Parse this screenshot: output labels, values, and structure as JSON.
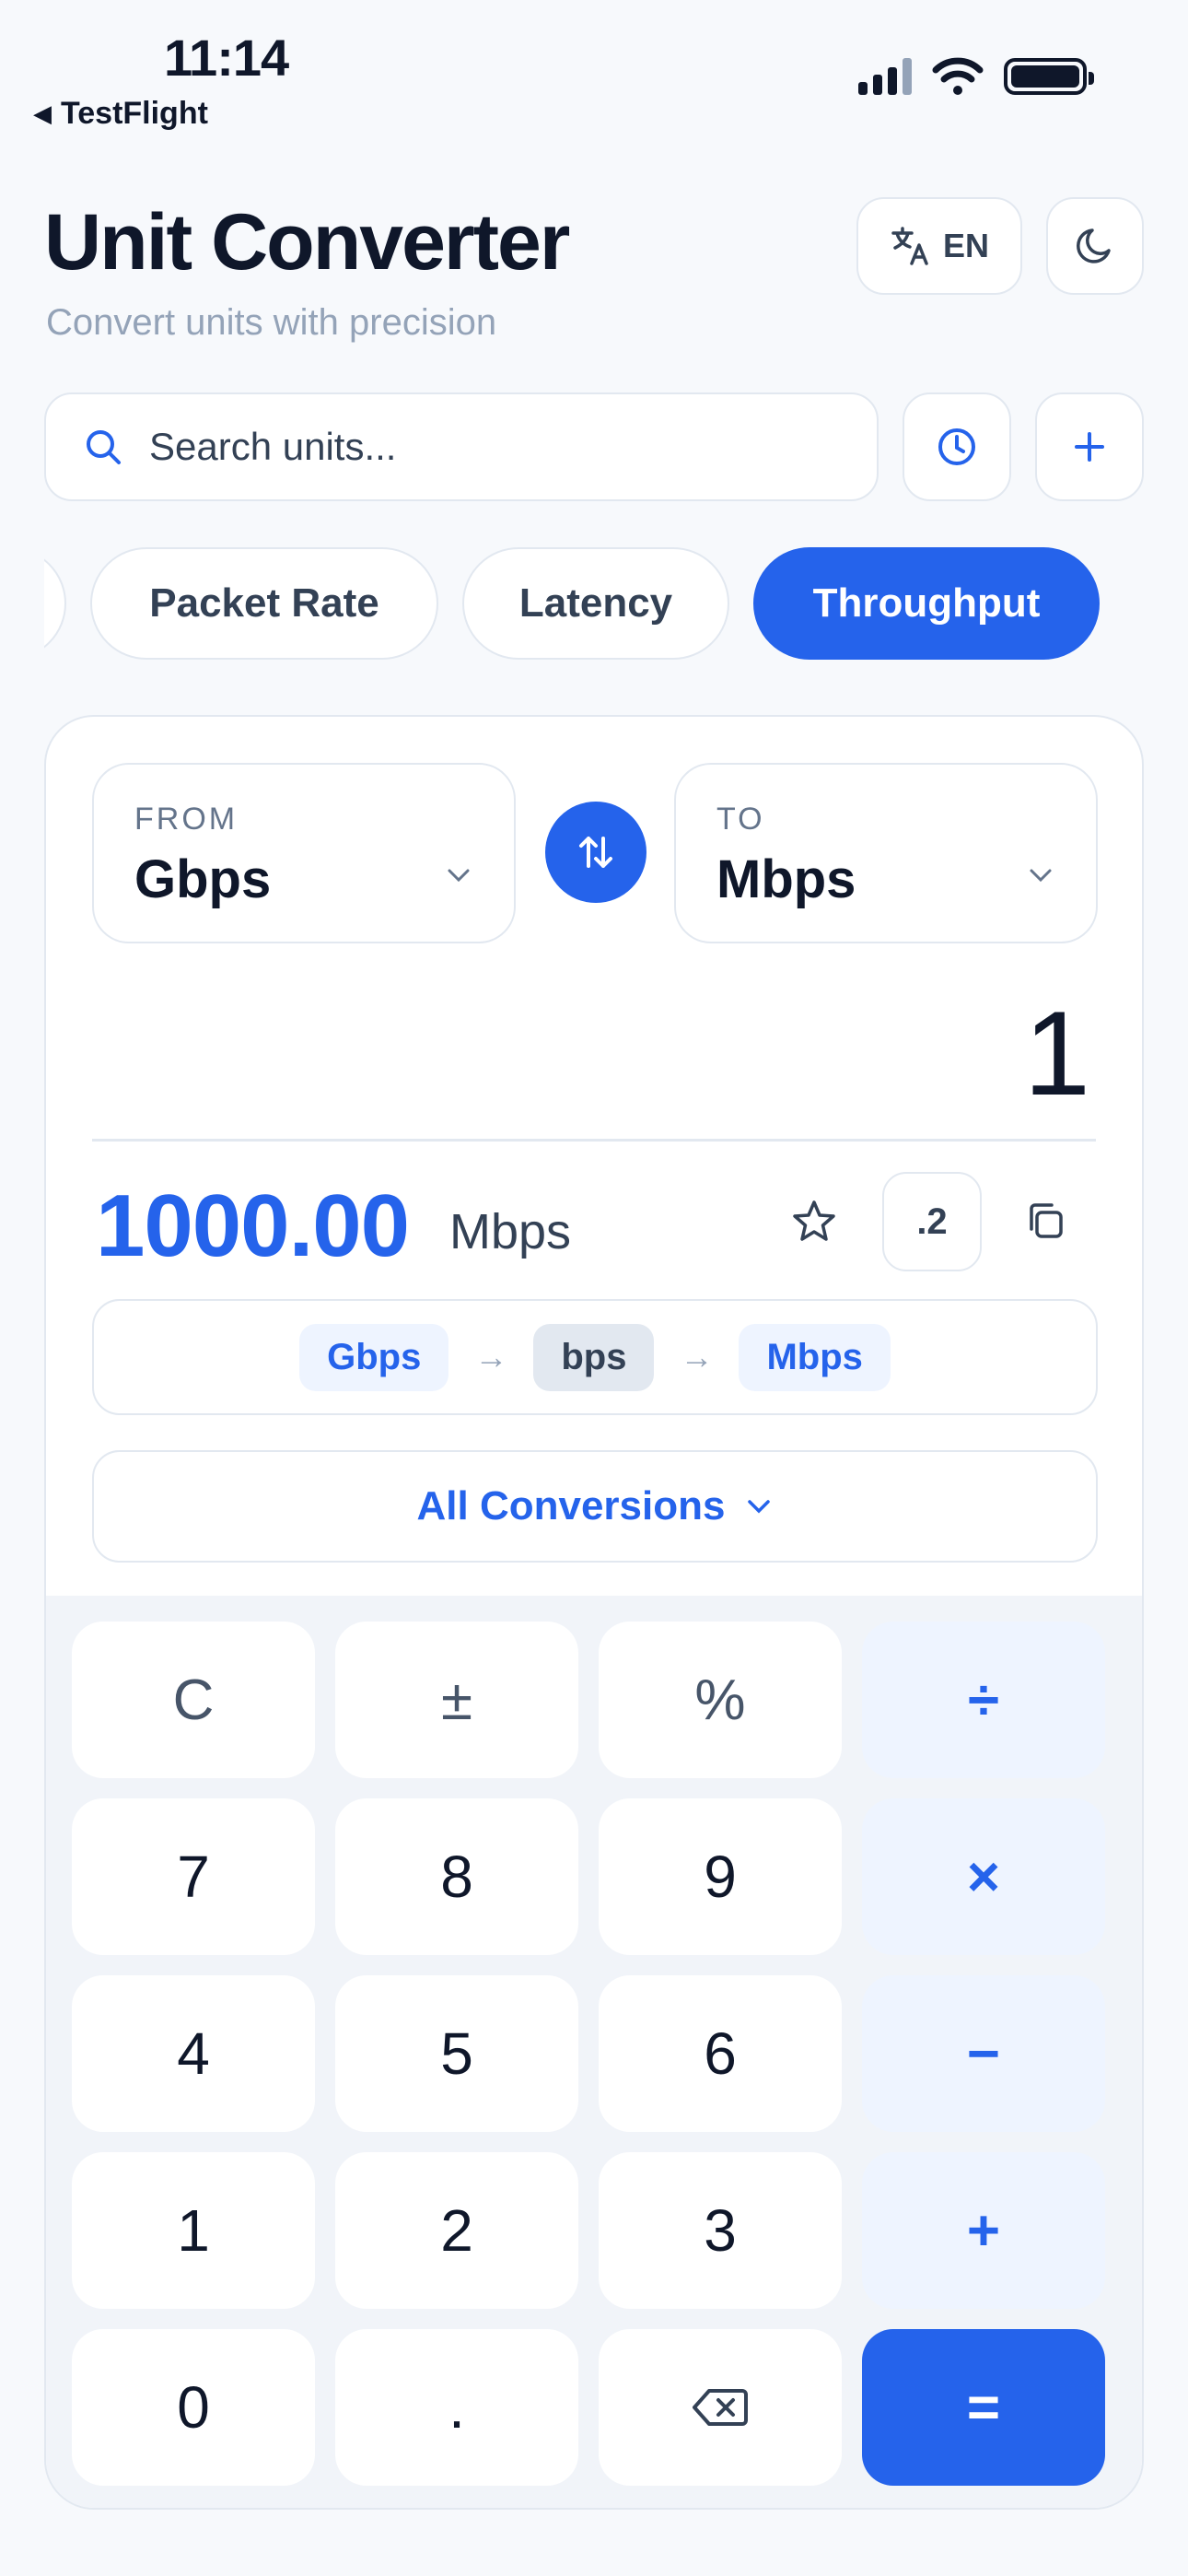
{
  "status": {
    "time": "11:14",
    "back_label": "TestFlight"
  },
  "header": {
    "title": "Unit Converter",
    "subtitle": "Convert units with precision",
    "language": "EN"
  },
  "search": {
    "placeholder": "Search units..."
  },
  "categories": [
    {
      "label": "Packet Rate",
      "active": false
    },
    {
      "label": "Latency",
      "active": false
    },
    {
      "label": "Throughput",
      "active": true
    }
  ],
  "converter": {
    "from": {
      "label": "FROM",
      "unit": "Gbps"
    },
    "to": {
      "label": "TO",
      "unit": "Mbps"
    },
    "input_value": "1",
    "result_value": "1000.00",
    "result_unit": "Mbps",
    "precision_label": ".2",
    "path": [
      "Gbps",
      "bps",
      "Mbps"
    ],
    "all_conversions_label": "All Conversions"
  },
  "keypad": {
    "rows": [
      [
        "C",
        "±",
        "%",
        "÷"
      ],
      [
        "7",
        "8",
        "9",
        "×"
      ],
      [
        "4",
        "5",
        "6",
        "−"
      ],
      [
        "1",
        "2",
        "3",
        "+"
      ],
      [
        "0",
        ".",
        "backspace",
        "="
      ]
    ]
  },
  "colors": {
    "accent": "#2563eb",
    "text": "#0f172a",
    "muted": "#94a3b8",
    "border": "#e2e8f0"
  }
}
